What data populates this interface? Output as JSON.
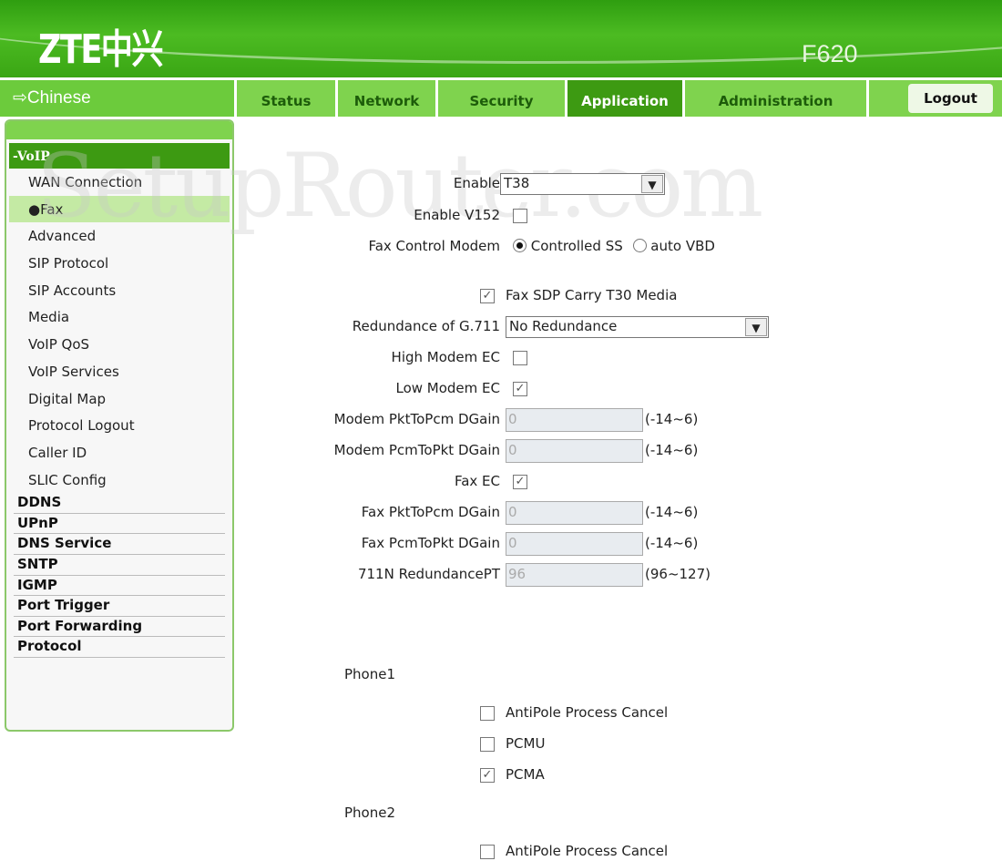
{
  "header": {
    "logo": "ZTE中兴",
    "model": "F620",
    "watermark": "SetupRouter.com"
  },
  "nav": {
    "language": "⇨Chinese",
    "tabs": [
      {
        "label": "Status"
      },
      {
        "label": "Network"
      },
      {
        "label": "Security"
      },
      {
        "label": "Application",
        "active": true
      },
      {
        "label": "Administration"
      }
    ],
    "logout": "Logout"
  },
  "colors": {
    "brand_green": "#4cbb22",
    "active_tab": "#3d9a12"
  },
  "sidebar": {
    "section": "-VoIP",
    "sub_items": [
      "WAN Connection",
      "●Fax",
      "Advanced",
      "SIP Protocol",
      "SIP Accounts",
      "Media",
      "VoIP QoS",
      "VoIP Services",
      "Digital Map",
      "Protocol Logout",
      "Caller ID",
      "SLIC Config"
    ],
    "selected": "Fax",
    "items": [
      "DDNS",
      "UPnP",
      "DNS Service",
      "SNTP",
      "IGMP",
      "Port Trigger",
      "Port Forwarding",
      "Protocol"
    ]
  },
  "form": {
    "enable": {
      "label": "Enable",
      "value": "T38"
    },
    "enable_v152": {
      "label": "Enable V152",
      "checked": false
    },
    "fax_control_modem": {
      "label": "Fax Control Modem",
      "options": [
        "Controlled SS",
        "auto VBD"
      ],
      "selected": "Controlled SS"
    },
    "fax_sdp": {
      "label": "Fax SDP Carry T30 Media",
      "checked": true
    },
    "redundance": {
      "label": "Redundance of G.711",
      "value": "No Redundance"
    },
    "high_modem_ec": {
      "label": "High Modem EC",
      "checked": false
    },
    "low_modem_ec": {
      "label": "Low Modem EC",
      "checked": true
    },
    "modem_pkt_to_pcm": {
      "label": "Modem PktToPcm DGain",
      "value": "0",
      "hint": "(-14~6)"
    },
    "modem_pcm_to_pkt": {
      "label": "Modem PcmToPkt DGain",
      "value": "0",
      "hint": "(-14~6)"
    },
    "fax_ec": {
      "label": "Fax EC",
      "checked": true
    },
    "fax_pkt_to_pcm": {
      "label": "Fax PktToPcm DGain",
      "value": "0",
      "hint": "(-14~6)"
    },
    "fax_pcm_to_pkt": {
      "label": "Fax PcmToPkt DGain",
      "value": "0",
      "hint": "(-14~6)"
    },
    "redundance_pt": {
      "label": "711N RedundancePT",
      "value": "96",
      "hint": "(96~127)"
    }
  },
  "phones": [
    {
      "label": "Phone1",
      "options": [
        {
          "label": "AntiPole Process Cancel",
          "checked": false
        },
        {
          "label": "PCMU",
          "checked": false
        },
        {
          "label": "PCMA",
          "checked": true
        }
      ]
    },
    {
      "label": "Phone2",
      "options": [
        {
          "label": "AntiPole Process Cancel",
          "checked": false
        }
      ]
    }
  ]
}
